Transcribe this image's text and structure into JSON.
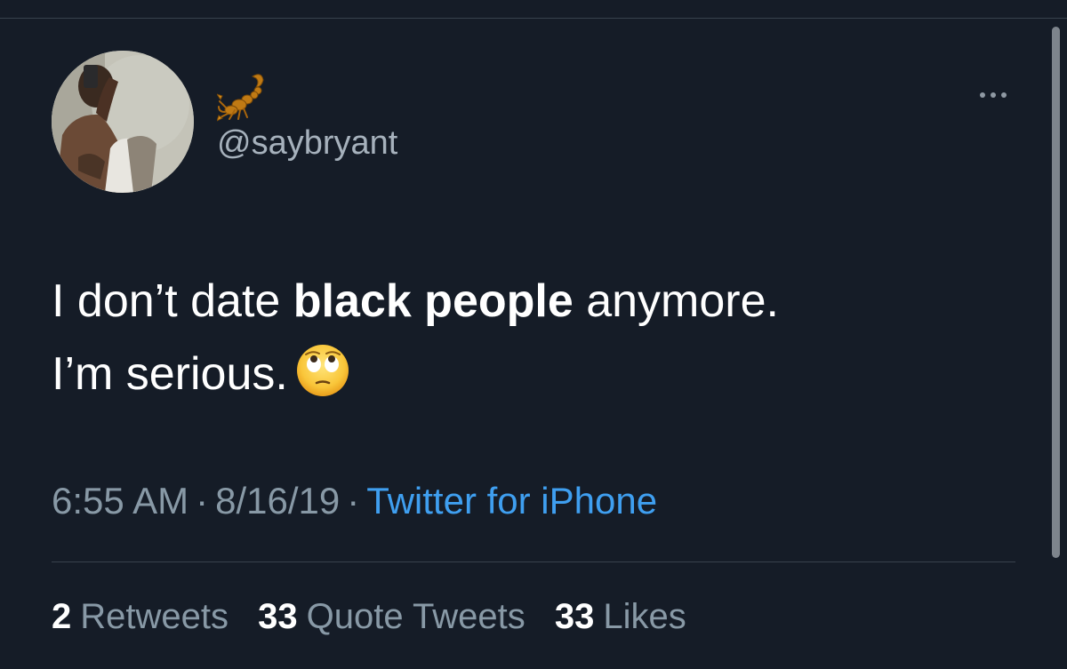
{
  "user": {
    "name_emoji": "scorpion-emoji",
    "handle": "@saybryant"
  },
  "tweet": {
    "text_part1": "I don’t date ",
    "text_bold": "black people",
    "text_part2": " anymore.",
    "line2": "I’m serious.",
    "emoji": "rolling-eyes-emoji"
  },
  "meta": {
    "time": "6:55 AM",
    "separator": "·",
    "date": "8/16/19",
    "source": "Twitter for iPhone"
  },
  "stats": {
    "retweets_count": "2",
    "retweets_label": "Retweets",
    "quotes_count": "33",
    "quotes_label": "Quote Tweets",
    "likes_count": "33",
    "likes_label": "Likes"
  },
  "colors": {
    "background": "#151c27",
    "secondary_text": "#8899a6",
    "link": "#3f9ff0",
    "primary_text": "#ffffff"
  }
}
